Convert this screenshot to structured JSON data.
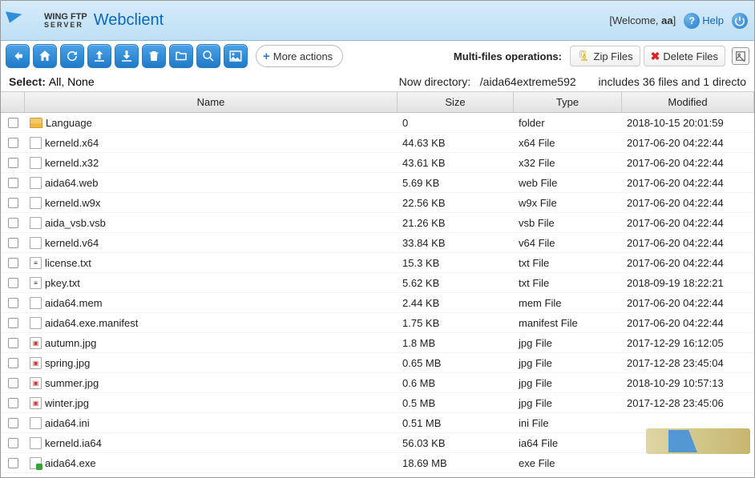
{
  "header": {
    "brand_top": "WING FTP",
    "brand_bottom": "SERVER",
    "webclient": "Webclient",
    "welcome_prefix": "[Welcome, ",
    "welcome_user": "aa",
    "welcome_suffix": "]",
    "help": "Help"
  },
  "toolbar": {
    "more_actions": "More actions",
    "multi_label": "Multi-files operations:",
    "zip_files": "Zip Files",
    "delete_files": "Delete Files"
  },
  "subbar": {
    "select": "Select:",
    "all": "All",
    "none": "None",
    "now_dir_label": "Now directory:",
    "path": "/aida64extreme592",
    "includes": "includes 36 files and 1 directo"
  },
  "columns": {
    "name": "Name",
    "size": "Size",
    "type": "Type",
    "modified": "Modified"
  },
  "files": [
    {
      "icon": "folder",
      "name": "Language",
      "size": "0",
      "type": "folder",
      "mod": "2018-10-15 20:01:59"
    },
    {
      "icon": "file",
      "name": "kerneld.x64",
      "size": "44.63 KB",
      "type": "x64 File",
      "mod": "2017-06-20 04:22:44"
    },
    {
      "icon": "file",
      "name": "kerneld.x32",
      "size": "43.61 KB",
      "type": "x32 File",
      "mod": "2017-06-20 04:22:44"
    },
    {
      "icon": "file",
      "name": "aida64.web",
      "size": "5.69 KB",
      "type": "web File",
      "mod": "2017-06-20 04:22:44"
    },
    {
      "icon": "file",
      "name": "kerneld.w9x",
      "size": "22.56 KB",
      "type": "w9x File",
      "mod": "2017-06-20 04:22:44"
    },
    {
      "icon": "file",
      "name": "aida_vsb.vsb",
      "size": "21.26 KB",
      "type": "vsb File",
      "mod": "2017-06-20 04:22:44"
    },
    {
      "icon": "file",
      "name": "kerneld.v64",
      "size": "33.84 KB",
      "type": "v64 File",
      "mod": "2017-06-20 04:22:44"
    },
    {
      "icon": "txt",
      "name": "license.txt",
      "size": "15.3 KB",
      "type": "txt File",
      "mod": "2017-06-20 04:22:44"
    },
    {
      "icon": "txt",
      "name": "pkey.txt",
      "size": "5.62 KB",
      "type": "txt File",
      "mod": "2018-09-19 18:22:21"
    },
    {
      "icon": "file",
      "name": "aida64.mem",
      "size": "2.44 KB",
      "type": "mem File",
      "mod": "2017-06-20 04:22:44"
    },
    {
      "icon": "file",
      "name": "aida64.exe.manifest",
      "size": "1.75 KB",
      "type": "manifest File",
      "mod": "2017-06-20 04:22:44"
    },
    {
      "icon": "img",
      "name": "autumn.jpg",
      "size": "1.8 MB",
      "type": "jpg File",
      "mod": "2017-12-29 16:12:05"
    },
    {
      "icon": "img",
      "name": "spring.jpg",
      "size": "0.65 MB",
      "type": "jpg File",
      "mod": "2017-12-28 23:45:04"
    },
    {
      "icon": "img",
      "name": "summer.jpg",
      "size": "0.6 MB",
      "type": "jpg File",
      "mod": "2018-10-29 10:57:13"
    },
    {
      "icon": "img",
      "name": "winter.jpg",
      "size": "0.5 MB",
      "type": "jpg File",
      "mod": "2017-12-28 23:45:06"
    },
    {
      "icon": "file",
      "name": "aida64.ini",
      "size": "0.51 MB",
      "type": "ini File",
      "mod": ""
    },
    {
      "icon": "file",
      "name": "kerneld.ia64",
      "size": "56.03 KB",
      "type": "ia64 File",
      "mod": ""
    },
    {
      "icon": "exe",
      "name": "aida64.exe",
      "size": "18.69 MB",
      "type": "exe File",
      "mod": ""
    }
  ]
}
